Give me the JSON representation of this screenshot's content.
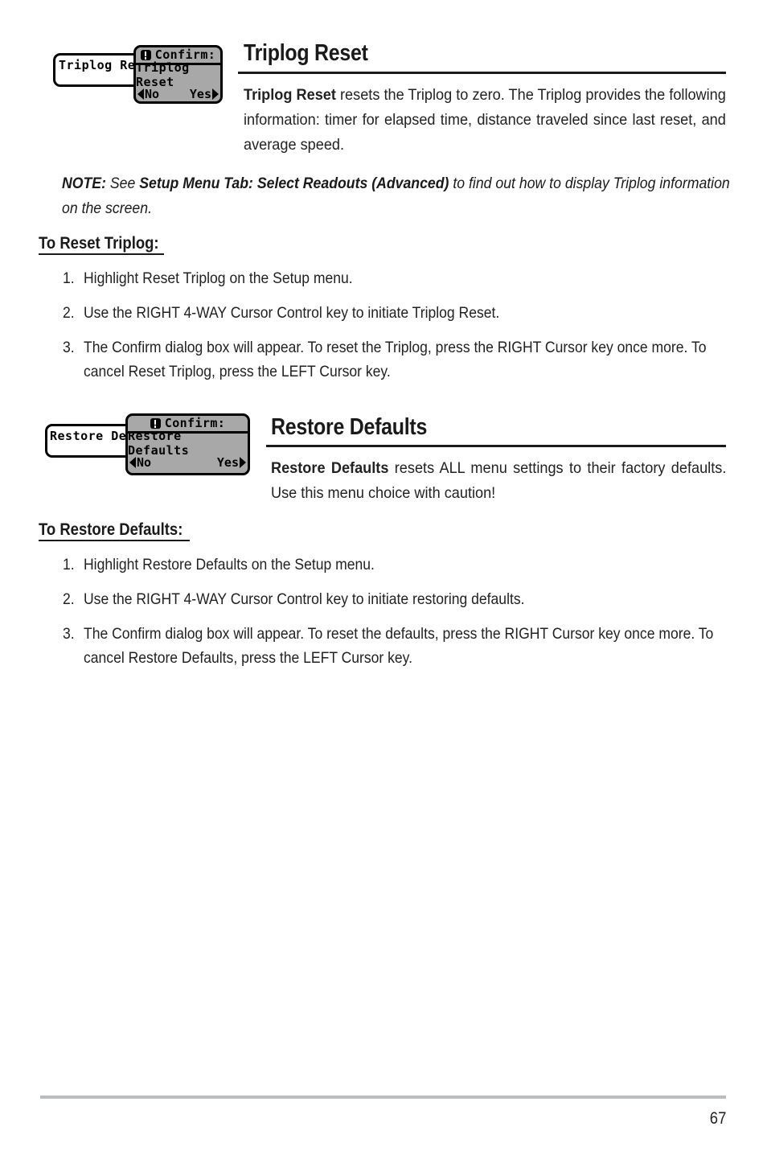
{
  "document": {
    "page_number": "67"
  },
  "sections": [
    {
      "id": "triplog-reset",
      "heading": "Triplog Reset",
      "body_lead": "Triplog Reset",
      "body_rest": " resets the Triplog to zero. The Triplog provides the following information: timer for elapsed time, distance traveled since last reset, and average speed.",
      "sub_heading": "To Reset Triplog:",
      "steps": [
        {
          "num": "1.",
          "text": "Highlight Reset Triplog on the Setup menu."
        },
        {
          "num": "2.",
          "text": "Use the RIGHT 4-WAY Cursor Control key to initiate Triplog Reset."
        },
        {
          "num": "3.",
          "text": "The Confirm dialog box will appear. To reset the Triplog, press the RIGHT Cursor key once more. To cancel Reset Triplog, press the LEFT Cursor key."
        }
      ],
      "figure": {
        "menu_box_label": "Triplog Rese",
        "dialog": {
          "title": "Confirm:",
          "message": "Triplog Reset",
          "no_label": "No",
          "yes_label": "Yes",
          "icon": "warning-exclamation-icon",
          "background_color": "#a8a8a8",
          "border_color": "#000000"
        }
      }
    },
    {
      "id": "restore-defaults",
      "heading": "Restore Defaults",
      "body_lead": "Restore Defaults",
      "body_rest": " resets ALL menu settings to their factory defaults. Use this menu choice with caution!",
      "sub_heading": "To Restore Defaults:",
      "steps": [
        {
          "num": "1.",
          "text": "Highlight Restore Defaults on the Setup menu."
        },
        {
          "num": "2.",
          "text": "Use the RIGHT 4-WAY Cursor Control key to initiate restoring defaults."
        },
        {
          "num": "3.",
          "text": "The Confirm dialog box will appear. To reset the defaults,  press the RIGHT Cursor key once more. To cancel Restore Defaults, press the LEFT Cursor key."
        }
      ],
      "figure": {
        "menu_box_label": "Restore De",
        "dialog": {
          "title": "Confirm:",
          "message": "Restore Defaults",
          "no_label": "No",
          "yes_label": "Yes",
          "icon": "warning-exclamation-icon",
          "background_color": "#a8a8a8",
          "border_color": "#000000"
        }
      }
    }
  ],
  "note": {
    "lead": "NOTE:",
    "text_before": "  See ",
    "emphasis": "Setup Menu Tab: Select Readouts (Advanced)",
    "text_after": " to find out how to display Triplog information on the screen."
  }
}
